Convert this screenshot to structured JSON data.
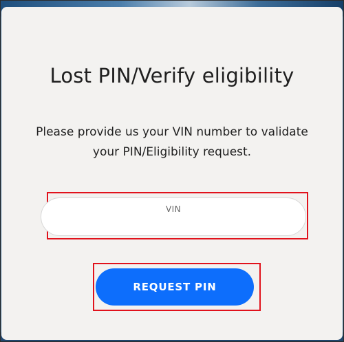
{
  "dialog": {
    "title": "Lost PIN/Verify eligibility",
    "description": "Please provide us your VIN number to validate your PIN/Eligibility request."
  },
  "vin_field": {
    "label": "VIN",
    "value": ""
  },
  "actions": {
    "request_pin_label": "REQUEST PIN"
  },
  "colors": {
    "modal_background": "#f3f2f0",
    "primary_button": "#0d6efc",
    "highlight_outline": "#e1121c"
  }
}
